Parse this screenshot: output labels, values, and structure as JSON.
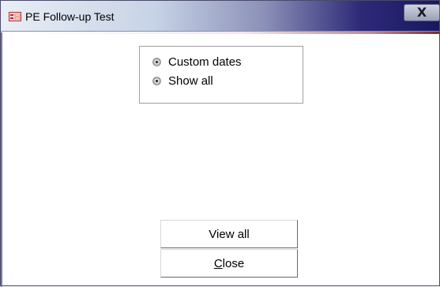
{
  "window": {
    "title": "PE Follow-up Test",
    "icon": "form-icon",
    "close_glyph": "X"
  },
  "options": {
    "items": [
      {
        "label": "Custom dates",
        "icon": "radio-icon"
      },
      {
        "label": "Show all",
        "icon": "radio-icon"
      }
    ]
  },
  "buttons": {
    "view_all_label": "View all",
    "close_label": "Close",
    "close_mnemonic": "C"
  },
  "colors": {
    "titlebar_dark": "#1a1760",
    "titlebar_light": "#e9eef6",
    "button_border": "#6a6a6a"
  }
}
